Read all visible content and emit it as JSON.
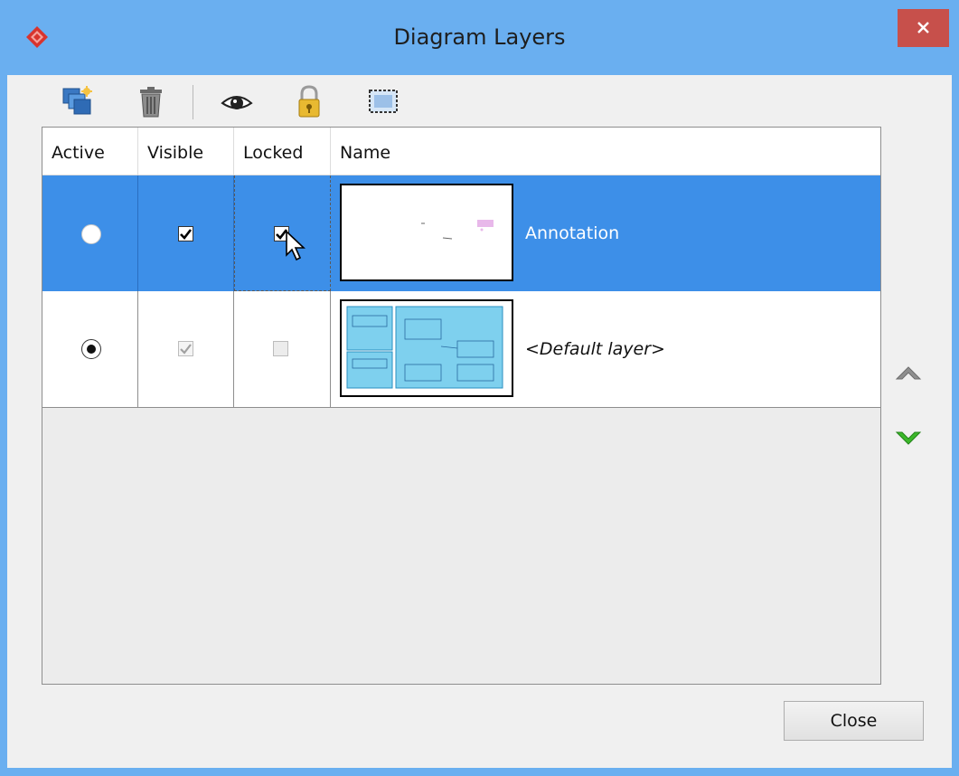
{
  "window": {
    "title": "Diagram Layers"
  },
  "toolbar": {
    "icons": [
      "new-layer-icon",
      "delete-icon",
      "eye-icon",
      "lock-icon",
      "select-area-icon"
    ]
  },
  "table": {
    "columns": {
      "active": "Active",
      "visible": "Visible",
      "locked": "Locked",
      "name": "Name"
    },
    "rows": [
      {
        "name": "Annotation",
        "active": false,
        "visible": true,
        "locked": true,
        "selected": true
      },
      {
        "name": "<Default layer>",
        "active": true,
        "visible": true,
        "locked": false,
        "selected": false
      }
    ]
  },
  "side_buttons": [
    "move-up-icon",
    "move-down-icon"
  ],
  "footer": {
    "close_label": "Close"
  },
  "colors": {
    "titlebar": "#6aaff0",
    "selection": "#3d8fe8",
    "close_red": "#c7504b",
    "down_arrow": "#3cb82a"
  }
}
